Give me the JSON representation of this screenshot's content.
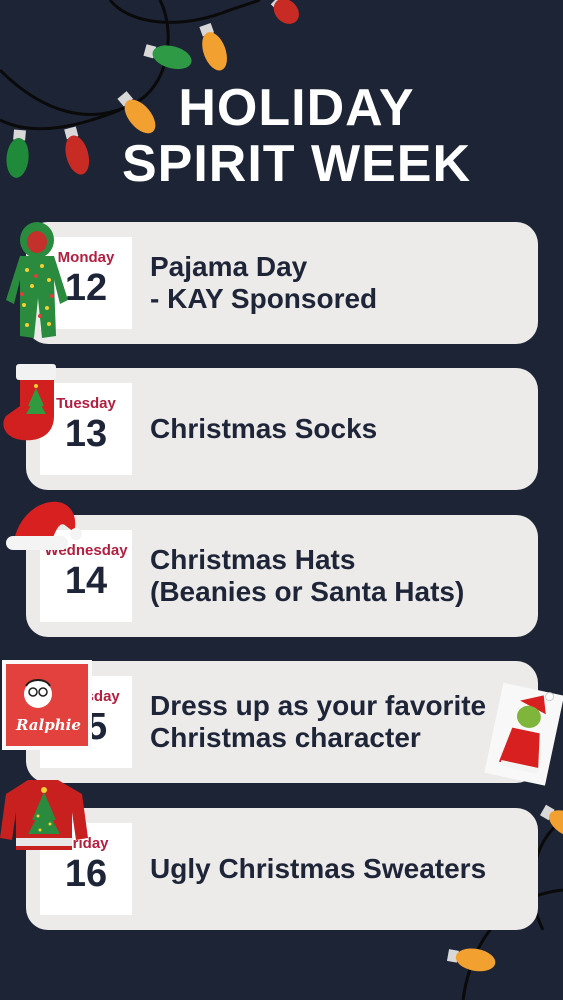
{
  "header": {
    "title_line1": "HOLIDAY",
    "title_line2": "SPIRIT WEEK"
  },
  "days": [
    {
      "day": "Monday",
      "date": "12",
      "event": "Pajama Day\n - KAY Sponsored"
    },
    {
      "day": "Tuesday",
      "date": "13",
      "event": "Christmas Socks"
    },
    {
      "day": "Wednesday",
      "date": "14",
      "event": "Christmas Hats\n(Beanies or Santa Hats)"
    },
    {
      "day": "Thursday",
      "date": "15",
      "event": "Dress up as your favorite\nChristmas character"
    },
    {
      "day": "Friday",
      "date": "16",
      "event": "Ugly Christmas Sweaters"
    }
  ],
  "stickers": {
    "ralphie_text": "Ralphie"
  },
  "colors": {
    "background": "#1d2435",
    "card": "#ecebe9",
    "accent_red": "#b3203f",
    "text_dark": "#1e2538"
  },
  "icons": [
    "christmas-lights-icon",
    "pajama-onesie-icon",
    "christmas-stocking-icon",
    "santa-hat-icon",
    "ralphie-sticker-icon",
    "ugly-sweater-icon",
    "grinch-icon"
  ]
}
